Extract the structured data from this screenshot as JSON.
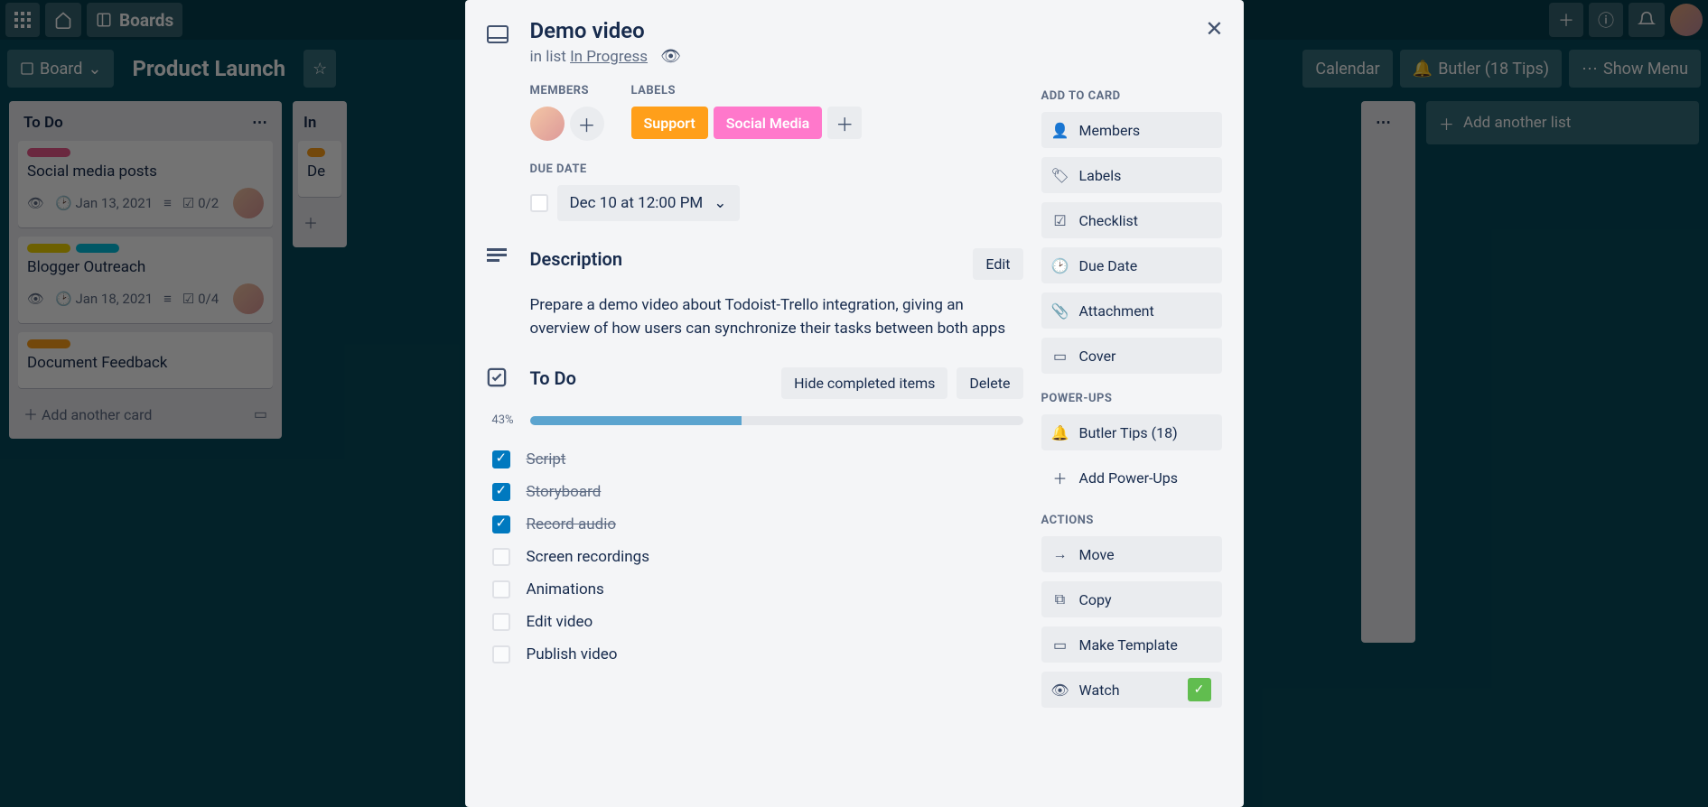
{
  "topbar": {
    "boards_label": "Boards"
  },
  "board_header": {
    "board_btn": "Board",
    "title": "Product Launch",
    "calendar": "Calendar",
    "butler": "Butler (18 Tips)",
    "show_menu": "Show Menu"
  },
  "bg_lists": {
    "todo": {
      "title": "To Do",
      "cards": [
        {
          "title": "Social media posts",
          "date": "Jan 13, 2021",
          "check": "0/2",
          "labels": [
            "#eb5a8d"
          ]
        },
        {
          "title": "Blogger Outreach",
          "date": "Jan 18, 2021",
          "check": "0/4",
          "labels": [
            "#f2d600",
            "#00c2e0"
          ]
        },
        {
          "title": "Document Feedback",
          "labels": [
            "#ff9f1a"
          ]
        }
      ],
      "add": "Add another card"
    },
    "inprog": {
      "title": "In",
      "card": "De"
    },
    "add_list": "Add another list"
  },
  "card": {
    "title": "Demo video",
    "in_list_prefix": "in list ",
    "in_list": "In Progress",
    "members_label": "MEMBERS",
    "labels_label": "LABELS",
    "labels": {
      "support": "Support",
      "social": "Social Media"
    },
    "due_label": "DUE DATE",
    "due_value": "Dec 10 at 12:00 PM",
    "description_title": "Description",
    "edit": "Edit",
    "description_text": "Prepare a demo video about Todoist-Trello integration, giving an overview of how users can synchronize their tasks between both apps",
    "checklist": {
      "title": "To Do",
      "hide": "Hide completed items",
      "delete": "Delete",
      "percent": "43%",
      "percent_val": 43,
      "items": [
        {
          "text": "Script",
          "done": true
        },
        {
          "text": "Storyboard",
          "done": true
        },
        {
          "text": "Record audio",
          "done": true
        },
        {
          "text": "Screen recordings",
          "done": false
        },
        {
          "text": "Animations",
          "done": false
        },
        {
          "text": "Edit video",
          "done": false
        },
        {
          "text": "Publish video",
          "done": false
        }
      ]
    },
    "sidebar": {
      "add_to_card": "ADD TO CARD",
      "members": "Members",
      "labels": "Labels",
      "checklist": "Checklist",
      "due_date": "Due Date",
      "attachment": "Attachment",
      "cover": "Cover",
      "powerups": "POWER-UPS",
      "butler_tips": "Butler Tips (18)",
      "add_powerups": "Add Power-Ups",
      "actions": "ACTIONS",
      "move": "Move",
      "copy": "Copy",
      "make_template": "Make Template",
      "watch": "Watch"
    }
  }
}
